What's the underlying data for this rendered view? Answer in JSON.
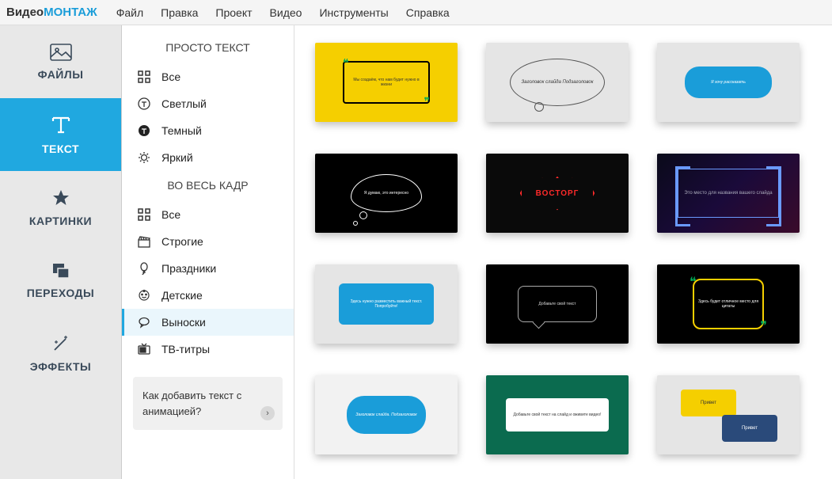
{
  "logo": {
    "part1": "Видео",
    "part2": "МОНТАЖ"
  },
  "menu": [
    "Файл",
    "Правка",
    "Проект",
    "Видео",
    "Инструменты",
    "Справка"
  ],
  "tabs": [
    {
      "id": "files",
      "label": "ФАЙЛЫ"
    },
    {
      "id": "text",
      "label": "ТЕКСТ",
      "active": true
    },
    {
      "id": "pictures",
      "label": "КАРТИНКИ"
    },
    {
      "id": "transitions",
      "label": "ПЕРЕХОДЫ"
    },
    {
      "id": "effects",
      "label": "ЭФФЕКТЫ"
    }
  ],
  "sections": {
    "simple": {
      "title": "ПРОСТО ТЕКСТ",
      "items": [
        {
          "id": "all",
          "label": "Все"
        },
        {
          "id": "light",
          "label": "Светлый"
        },
        {
          "id": "dark",
          "label": "Темный"
        },
        {
          "id": "bright",
          "label": "Яркий"
        }
      ]
    },
    "full": {
      "title": "ВО ВЕСЬ КАДР",
      "items": [
        {
          "id": "all2",
          "label": "Все"
        },
        {
          "id": "strict",
          "label": "Строгие"
        },
        {
          "id": "holidays",
          "label": "Праздники"
        },
        {
          "id": "kids",
          "label": "Детские"
        },
        {
          "id": "callouts",
          "label": "Выноски",
          "selected": true
        },
        {
          "id": "tv",
          "label": "ТВ-титры"
        }
      ]
    }
  },
  "help": {
    "text": "Как добавить текст с анимацией?",
    "arrow": "›"
  },
  "thumbs": [
    {
      "cls": "t1",
      "text": "Мы создаём, что нам будет нужно в жизни"
    },
    {
      "cls": "t2",
      "text": "Заголовок слайда\nПодзаголовок"
    },
    {
      "cls": "t3",
      "text": "Я хочу рассказать"
    },
    {
      "cls": "t4",
      "text": "Я думаю,\nэто интересно"
    },
    {
      "cls": "t5",
      "text": "ВОСТОРГ"
    },
    {
      "cls": "t6",
      "text": "Это место для названия\nвашего слайда"
    },
    {
      "cls": "t7",
      "text": "Здесь нужно\nразместить важный\nтекст.\nПопробуйте!"
    },
    {
      "cls": "t8",
      "text": "Добавьте\nсвой текст"
    },
    {
      "cls": "t9",
      "text": "Здесь будет\nотличное место\nдля цитаты"
    },
    {
      "cls": "t10",
      "text": "Заголовок слайда.\nПодзаголовок"
    },
    {
      "cls": "t11",
      "text": "Добавьте свой текст\nна слайд и оживите видео!"
    },
    {
      "cls": "t12",
      "text1": "Привет",
      "text2": "Привет"
    }
  ]
}
